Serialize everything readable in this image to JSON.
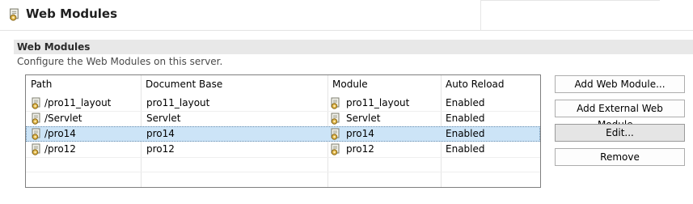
{
  "header": {
    "title": "Web Modules",
    "icon": "server-module-icon"
  },
  "section": {
    "title": "Web Modules",
    "description": "Configure the Web Modules on this server."
  },
  "table": {
    "columns": [
      "Path",
      "Document Base",
      "Module",
      "Auto Reload"
    ],
    "rows": [
      {
        "path": "/pro11_layout",
        "document_base": "pro11_layout",
        "module": "pro11_layout",
        "auto_reload": "Enabled",
        "selected": false
      },
      {
        "path": "/Servlet",
        "document_base": "Servlet",
        "module": "Servlet",
        "auto_reload": "Enabled",
        "selected": false
      },
      {
        "path": "/pro14",
        "document_base": "pro14",
        "module": "pro14",
        "auto_reload": "Enabled",
        "selected": true
      },
      {
        "path": "/pro12",
        "document_base": "pro12",
        "module": "pro12",
        "auto_reload": "Enabled",
        "selected": false
      }
    ]
  },
  "buttons": {
    "add_web_module": "Add Web Module...",
    "add_external_web_module": "Add External Web Module...",
    "edit": "Edit...",
    "remove": "Remove"
  },
  "colors": {
    "selection": "#cce4f7",
    "section_bar": "#e8e8e8"
  }
}
